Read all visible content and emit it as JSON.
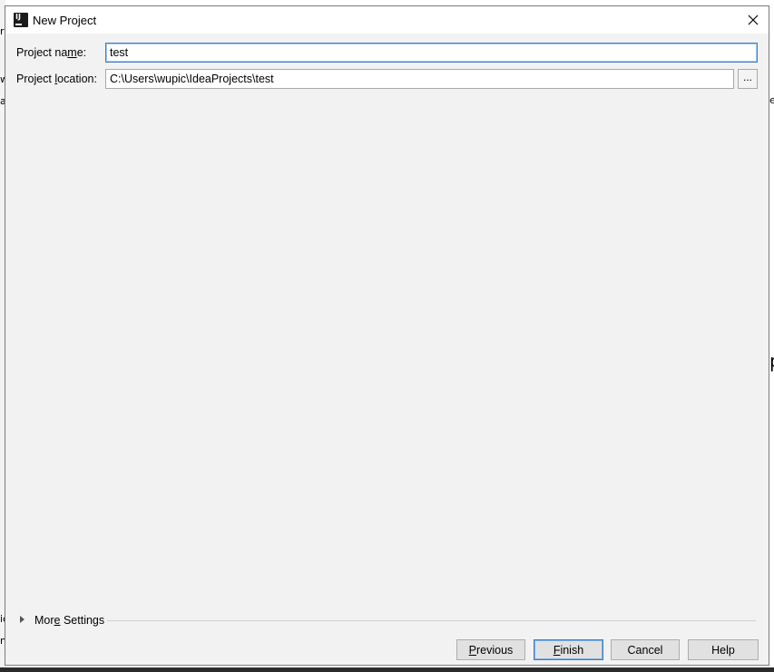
{
  "window": {
    "title": "New Project",
    "icon": "intellij-idea-icon"
  },
  "form": {
    "project_name": {
      "label_pre": "Project na",
      "label_mnemonic": "m",
      "label_post": "e:",
      "value": "test"
    },
    "project_location": {
      "label_pre": "Project ",
      "label_mnemonic": "l",
      "label_post": "ocation:",
      "value": "C:\\Users\\wupic\\IdeaProjects\\test",
      "browse_label": "..."
    }
  },
  "more_settings": {
    "label_pre": "Mor",
    "label_mnemonic": "e",
    "label_post": " Settings",
    "expanded": false
  },
  "buttons": {
    "previous": {
      "mnemonic": "P",
      "rest": "revious"
    },
    "finish": {
      "mnemonic": "F",
      "rest": "inish"
    },
    "cancel": {
      "label": "Cancel"
    },
    "help": {
      "label": "Help"
    }
  },
  "background_fragments": {
    "left_chars": [
      "r",
      "w",
      "a",
      "ic",
      "nl"
    ],
    "right_chars": [
      "e",
      "p"
    ]
  },
  "colors": {
    "dialog_bg": "#f2f2f2",
    "titlebar_bg": "#ffffff",
    "focus_border": "#3d7cc4",
    "button_bg": "#e1e1e1"
  }
}
